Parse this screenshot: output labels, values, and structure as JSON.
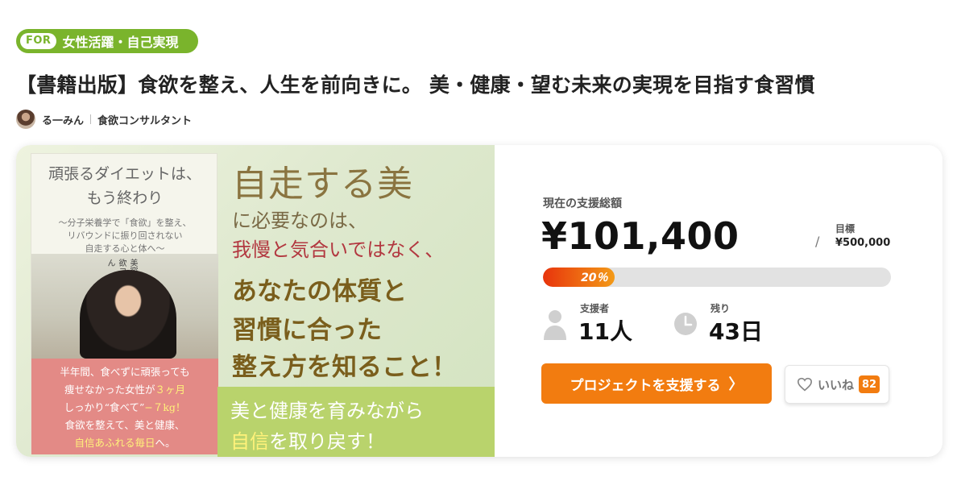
{
  "category_tag": {
    "prefix": "FOR",
    "label": "女性活躍・自己実現"
  },
  "title": "【書籍出版】食欲を整え、人生を前向きに。 美・健康・望む未来の実現を目指す食習慣",
  "author": {
    "name": "る一みん",
    "role": "食欲コンサルタント"
  },
  "banner": {
    "book_title_1": "頑張るダイエットは、",
    "book_title_2": "もう終わり",
    "book_sub_1": "〜分子栄養学で「食欲」を整え、",
    "book_sub_2": "リバウンドに振り回されない",
    "book_sub_3": "自走する心と体へ〜",
    "book_photo_text": "美容業界15年の集大成 食欲コンサルタント るーみん",
    "book_pink_1": "半年間、食べずに頑張っても",
    "book_pink_2a": "痩せなかった女性が",
    "book_pink_2b": "３ヶ月",
    "book_pink_3a": "しっかり“食べて”",
    "book_pink_3b": "−７kg！",
    "book_pink_4": "食欲を整えて、美と健康、",
    "book_pink_5a": "自信あふれる毎日",
    "book_pink_5b": "へ。",
    "headline": "自走する美",
    "line1": "に必要なのは、",
    "line2": "我慢と気合いではなく、",
    "line3": "あなたの体質と",
    "line4": "習慣に合った",
    "line5": "整え方を知ること！",
    "green1": "美と健康を育みながら",
    "green2a": "自信",
    "green2b": "を取り戻す！"
  },
  "funding": {
    "total_label": "現在の支援総額",
    "total_amount": "¥101,400",
    "goal_slash": "/",
    "goal_label": "目標",
    "goal_amount": "¥500,000",
    "progress_text": "20％",
    "progress_percent": 20,
    "backers_label": "支援者",
    "backers_value": "11人",
    "days_label": "残り",
    "days_value": "43日",
    "support_label": "プロジェクトを支援する",
    "support_chevron": "〉",
    "like_label": "いいね",
    "like_count": "82"
  },
  "colors": {
    "accent_orange": "#f27c10",
    "tag_green": "#7ab42c",
    "progress_red": "#e8340c"
  },
  "icons": {
    "backers": "person-icon",
    "days": "clock-icon",
    "like": "heart-icon"
  }
}
